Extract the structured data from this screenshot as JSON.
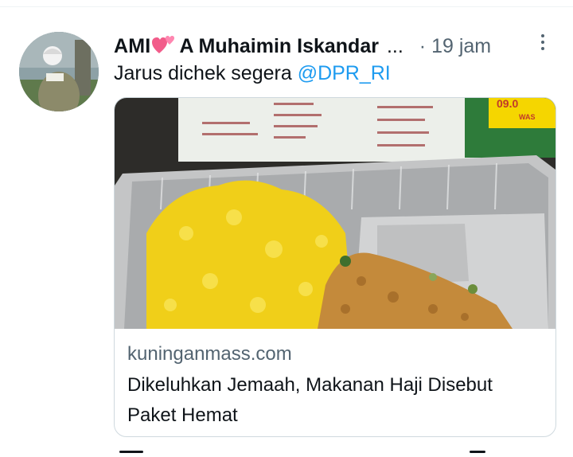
{
  "tweet": {
    "author_name": "AMI",
    "author_name_rest": "A Muhaimin Iskandar",
    "truncation": "...",
    "timestamp": "· 19 jam",
    "text": "Jarus dichek segera ",
    "mention": "@DPR_RI",
    "more_icon": "more-vertical-icon",
    "heart_emoji_icon": "two-hearts-icon"
  },
  "card": {
    "domain": "kuninganmass.com",
    "title": "Dikeluhkan Jemaah, Makanan Haji Disebut Paket Hemat",
    "image_description_icon": "yellow-rice-meal-tray-image",
    "sign_price": "09.0",
    "sign_unit": "WAS"
  },
  "colors": {
    "text": "#0f1419",
    "secondary": "#536471",
    "link": "#1d9bf0",
    "border": "#cfd9de"
  }
}
